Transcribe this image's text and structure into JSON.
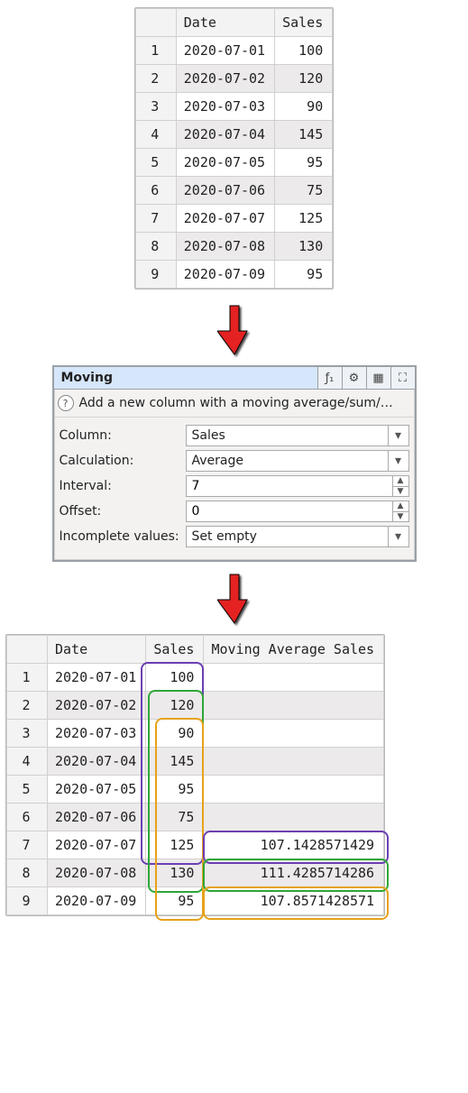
{
  "input_table": {
    "columns": [
      "Date",
      "Sales"
    ],
    "rows": [
      {
        "idx": "1",
        "date": "2020-07-01",
        "sales": "100"
      },
      {
        "idx": "2",
        "date": "2020-07-02",
        "sales": "120"
      },
      {
        "idx": "3",
        "date": "2020-07-03",
        "sales": "90"
      },
      {
        "idx": "4",
        "date": "2020-07-04",
        "sales": "145"
      },
      {
        "idx": "5",
        "date": "2020-07-05",
        "sales": "95"
      },
      {
        "idx": "6",
        "date": "2020-07-06",
        "sales": "75"
      },
      {
        "idx": "7",
        "date": "2020-07-07",
        "sales": "125"
      },
      {
        "idx": "8",
        "date": "2020-07-08",
        "sales": "130"
      },
      {
        "idx": "9",
        "date": "2020-07-09",
        "sales": "95"
      }
    ]
  },
  "dialog": {
    "title": "Moving",
    "hint_text": "Add a new column with a moving average/sum/…",
    "labels": {
      "column": "Column:",
      "calculation": "Calculation:",
      "interval": "Interval:",
      "offset": "Offset:",
      "incomplete": "Incomplete values:"
    },
    "values": {
      "column": "Sales",
      "calculation": "Average",
      "interval": "7",
      "offset": "0",
      "incomplete": "Set empty"
    }
  },
  "output_table": {
    "columns": [
      "Date",
      "Sales",
      "Moving Average Sales"
    ],
    "rows": [
      {
        "idx": "1",
        "date": "2020-07-01",
        "sales": "100",
        "movavg": ""
      },
      {
        "idx": "2",
        "date": "2020-07-02",
        "sales": "120",
        "movavg": ""
      },
      {
        "idx": "3",
        "date": "2020-07-03",
        "sales": "90",
        "movavg": ""
      },
      {
        "idx": "4",
        "date": "2020-07-04",
        "sales": "145",
        "movavg": ""
      },
      {
        "idx": "5",
        "date": "2020-07-05",
        "sales": "95",
        "movavg": ""
      },
      {
        "idx": "6",
        "date": "2020-07-06",
        "sales": "75",
        "movavg": ""
      },
      {
        "idx": "7",
        "date": "2020-07-07",
        "sales": "125",
        "movavg": "107.1428571429"
      },
      {
        "idx": "8",
        "date": "2020-07-08",
        "sales": "130",
        "movavg": "111.4285714286"
      },
      {
        "idx": "9",
        "date": "2020-07-09",
        "sales": "95",
        "movavg": "107.8571428571"
      }
    ]
  }
}
